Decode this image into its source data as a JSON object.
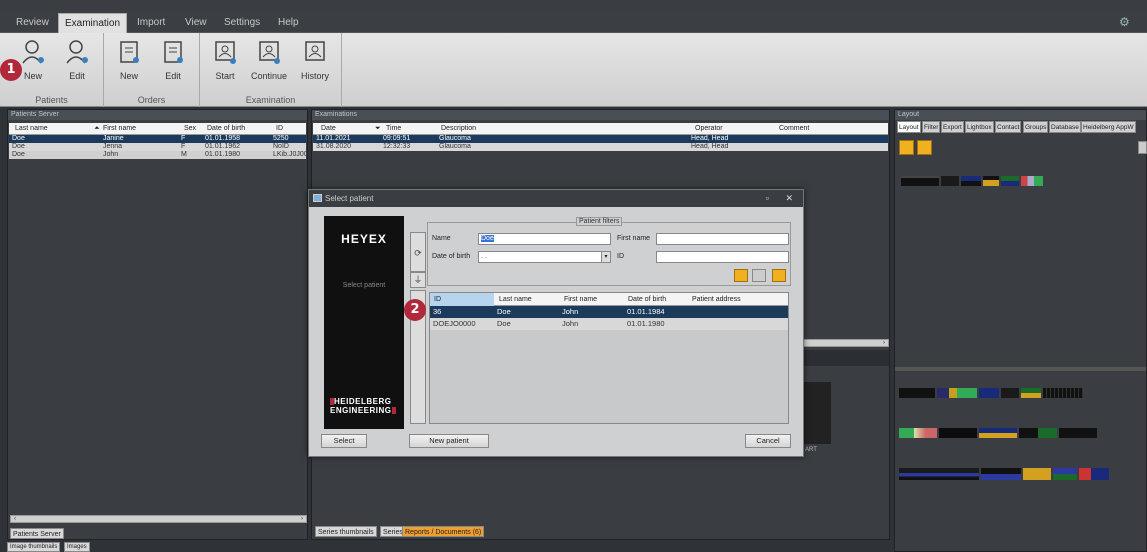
{
  "menu_tabs": [
    "Review",
    "Examination",
    "Import",
    "View",
    "Settings",
    "Help"
  ],
  "active_tab": "Examination",
  "ribbon": {
    "patients": {
      "label": "Patients",
      "new": "New",
      "edit": "Edit"
    },
    "orders": {
      "label": "Orders",
      "new": "New",
      "edit": "Edit"
    },
    "examination": {
      "label": "Examination",
      "start": "Start",
      "continue": "Continue",
      "history": "History"
    }
  },
  "badges": [
    "1",
    "2"
  ],
  "patients_server": {
    "title": "Patients Server",
    "columns": [
      "Last name",
      "First name",
      "Sex",
      "Date of birth",
      "ID"
    ],
    "rows": [
      [
        "Doe",
        "Janine",
        "F",
        "01.01.1958",
        "5250"
      ],
      [
        "Doe",
        "Jenna",
        "F",
        "01.01.1962",
        "NoID"
      ],
      [
        "Doe",
        "John",
        "M",
        "01.01.1980",
        "LKib.J0J00"
      ]
    ],
    "bottom_tab": "Patients Server",
    "footer_tabs": [
      "Image thumbnails",
      "Images"
    ]
  },
  "examinations": {
    "title": "Examinations",
    "columns": [
      "Date",
      "Time",
      "Description",
      "Operator",
      "Comment"
    ],
    "rows": [
      [
        "11.01.2021",
        "09:09:51",
        "Glaucoma",
        "Head, Head",
        ""
      ],
      [
        "31.08.2020",
        "12:32:33",
        "Glaucoma",
        "Head, Head",
        ""
      ]
    ],
    "bottom_tabs": [
      "Series thumbnails",
      "Series",
      "Reports / Documents (6)"
    ],
    "art_label": "ART"
  },
  "layout_panel": {
    "title": "Layout",
    "tabs": [
      "Layout",
      "Filter",
      "Export",
      "Lightbox",
      "Contact",
      "Groups",
      "Database",
      "Heidelberg AppW"
    ]
  },
  "dialog": {
    "title": "Select patient",
    "brand": "HEYEX",
    "brand_sub": "Select patient",
    "brand_logo_1": "HEIDELBERG",
    "brand_logo_2": "ENGINEERING",
    "filters_label": "Patient filters",
    "name_label": "Name",
    "name_value": "Doe",
    "first_name_label": "First name",
    "first_name_value": "",
    "dob_label": "Date of birth",
    "dob_value": ". .",
    "id_label": "ID",
    "id_value": "",
    "columns": [
      "ID",
      "Last name",
      "First name",
      "Date of birth",
      "Patient address"
    ],
    "rows": [
      [
        "36",
        "Doe",
        "John",
        "01.01.1984",
        ""
      ],
      [
        "DOEJO0000",
        "Doe",
        "John",
        "01.01.1980",
        ""
      ]
    ],
    "select_button": "Select",
    "new_patient_button": "New patient",
    "cancel_button": "Cancel"
  },
  "colors": {
    "accent_red": "#b1283a",
    "selection_blue": "#1c3a5c",
    "highlight_orange": "#f0a030"
  }
}
